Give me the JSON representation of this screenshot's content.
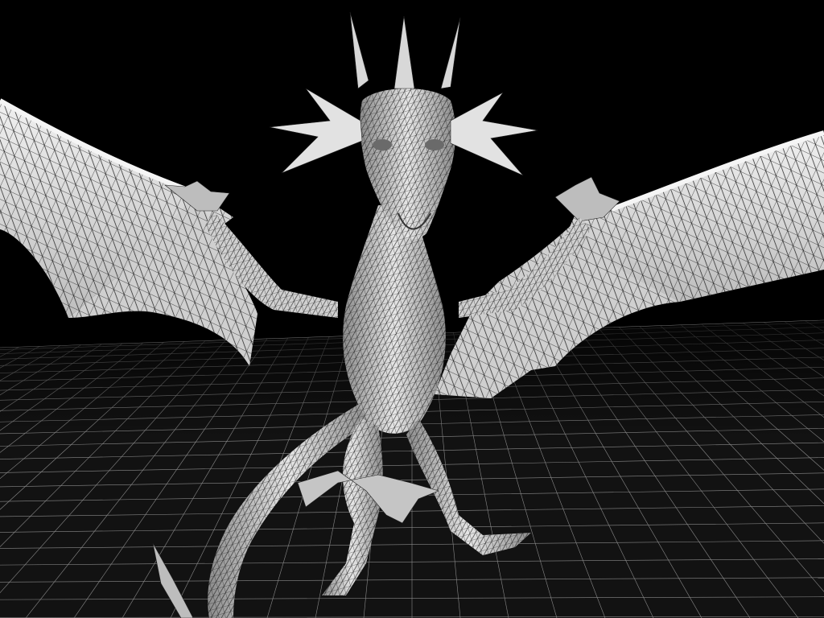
{
  "viewport": {
    "background_color": "#000000",
    "grid_color": "#8a8a8a",
    "grid_floor_color": "#121212",
    "mesh_fill_color": "#d8d8d8",
    "mesh_shadow_color": "#8c8c8c",
    "wire_color": "#1a1a1a",
    "model": "dragon",
    "display_mode": "wireframe-on-shaded"
  }
}
